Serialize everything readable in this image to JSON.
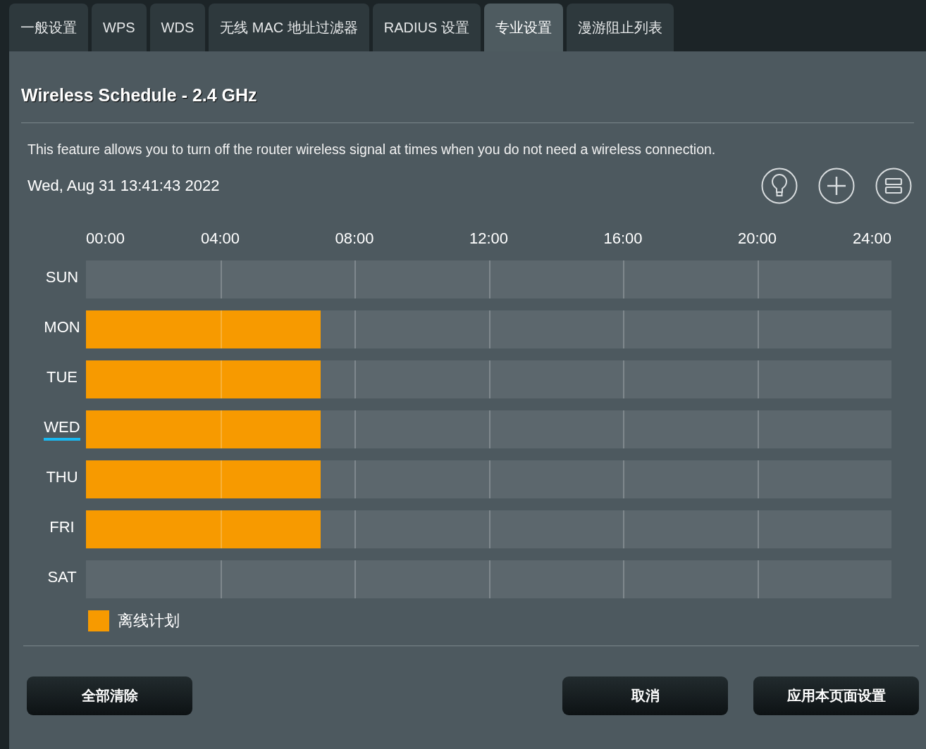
{
  "tabs": [
    {
      "label": "一般设置",
      "selected": false
    },
    {
      "label": "WPS",
      "selected": false
    },
    {
      "label": "WDS",
      "selected": false
    },
    {
      "label": "无线 MAC 地址过滤器",
      "selected": false
    },
    {
      "label": "RADIUS 设置",
      "selected": false
    },
    {
      "label": "专业设置",
      "selected": true
    },
    {
      "label": "漫游阻止列表",
      "selected": false
    }
  ],
  "title": "Wireless Schedule - 2.4 GHz",
  "description": "This feature allows you to turn off the router wireless signal at times when you do not need a wireless connection.",
  "datetime": "Wed, Aug 31 13:41:43 2022",
  "schedule": {
    "hours": [
      "00:00",
      "04:00",
      "08:00",
      "12:00",
      "16:00",
      "20:00",
      "24:00"
    ],
    "days": [
      {
        "label": "SUN",
        "selected": false
      },
      {
        "label": "MON",
        "selected": false,
        "level": 0.2917
      },
      {
        "label": "TUE",
        "selected": false,
        "level": 0.2917
      },
      {
        "label": "WED",
        "selected": true,
        "level": 0.2917
      },
      {
        "label": "THU",
        "selected": false,
        "level": 0.2917
      },
      {
        "label": "FRI",
        "selected": false,
        "level": 0.2917
      },
      {
        "label": "SAT",
        "selected": false
      }
    ]
  },
  "legend": {
    "label": "离线计划"
  },
  "buttons": {
    "left": [
      "全部清除"
    ],
    "right": [
      "取消",
      "应用本页面设置"
    ]
  }
}
